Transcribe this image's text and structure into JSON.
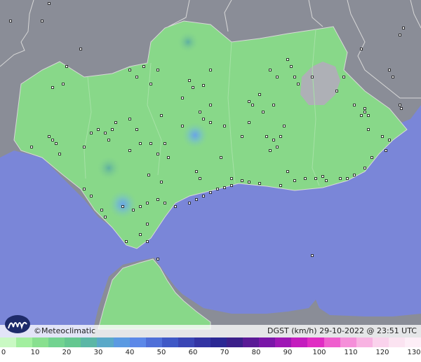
{
  "map": {
    "credit": "©Meteoclimatic",
    "caption": "DGST (km/h)  29-10-2022 @ 23:51 UTC",
    "colors": {
      "sea": "#7a86d8",
      "land_outside": "#8a8d97",
      "land_andalusia": "#88d889",
      "border": "#cfcfcf"
    },
    "icons": {
      "logo": "meteoclimatic-logo-icon",
      "station": "station-marker-icon"
    }
  },
  "legend": {
    "ticks": [
      "0",
      "10",
      "20",
      "30",
      "40",
      "50",
      "60",
      "70",
      "80",
      "90",
      "100",
      "110",
      "120",
      "130"
    ],
    "colors": [
      "#c9f9c3",
      "#a2ef9f",
      "#88e08f",
      "#72d390",
      "#64c790",
      "#5bb7a6",
      "#5aa9c8",
      "#5b9ae2",
      "#5c88e8",
      "#4f6fd8",
      "#3f58c6",
      "#3a46b5",
      "#3334a3",
      "#2b2894",
      "#3b1f8a",
      "#5a1a96",
      "#7a16a8",
      "#9e17b5",
      "#c41cbe",
      "#e02dc3",
      "#ef5fce",
      "#f58fd9",
      "#f8b3e2",
      "#fad2ec",
      "#fbe3f1",
      "#fdeef7"
    ]
  }
}
